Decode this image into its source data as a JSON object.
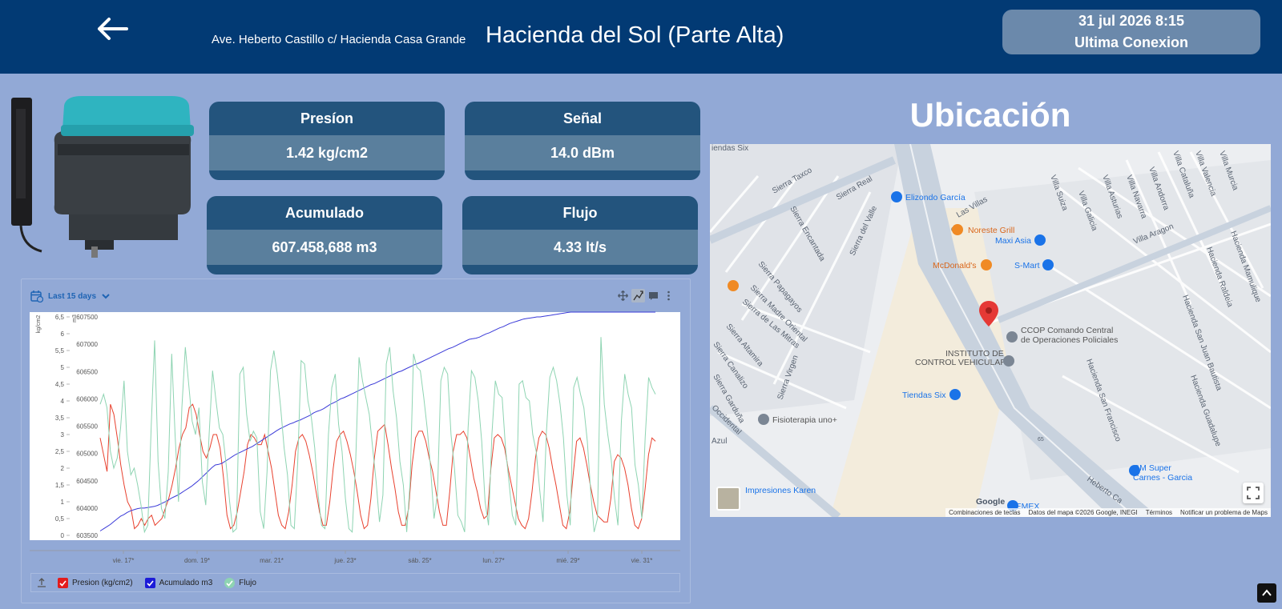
{
  "header": {
    "address": "Ave. Heberto Castillo c/ Hacienda Casa Grande",
    "title": "Hacienda del Sol (Parte Alta)",
    "last_connection_datetime": "31 jul 2026 8:15",
    "last_connection_label": "Ultima Conexion",
    "back_icon": "arrow-left-icon"
  },
  "cards": {
    "pressure": {
      "label": "Presíon",
      "value": "1.42 kg/cm2"
    },
    "signal": {
      "label": "Señal",
      "value": "14.0 dBm"
    },
    "accumulated": {
      "label": "Acumulado",
      "value": "607.458,688 m3"
    },
    "flow": {
      "label": "Flujo",
      "value": "4.33 lt/s"
    }
  },
  "chart_controls": {
    "range_label": "Last 15 days",
    "range_icon": "calendar-icon",
    "tools": [
      "move-icon",
      "zoom-icon",
      "comment-icon",
      "more-vertical-icon"
    ]
  },
  "chart_data": {
    "type": "line",
    "x": [
      "vie. 17*",
      "dom. 19*",
      "mar. 21*",
      "jue. 23*",
      "sáb. 25*",
      "lun. 27*",
      "mié. 29*",
      "vie. 31*"
    ],
    "left_axis": {
      "label": "kg/cm2",
      "ticks": [
        "6,5",
        "6",
        "5,5",
        "5",
        "4,5",
        "4",
        "3,5",
        "3",
        "2,5",
        "2",
        "1,5",
        "1",
        "0,5",
        "0"
      ],
      "ylim": [
        0,
        6.5
      ]
    },
    "right_axis": {
      "label": "m3",
      "ticks": [
        "607500",
        "607000",
        "606500",
        "606000",
        "605500",
        "605000",
        "604500",
        "604000",
        "603500"
      ],
      "ylim": [
        603500,
        607500
      ]
    },
    "series": [
      {
        "name": "Presion (kg/cm2)",
        "color": "#e8412e",
        "axis": "left",
        "values": [
          2.9,
          2.4,
          1.9,
          3.9,
          3.6,
          2.9,
          2.1,
          1.5,
          1.0,
          0.8,
          0.2,
          0.3,
          0.5,
          0.3,
          0.5,
          0.6,
          0.3,
          0.4,
          0.5,
          0.8,
          1.1,
          1.5,
          2.0,
          2.6,
          3.0,
          3.2,
          3.8,
          3.9,
          3.6,
          3.0,
          2.5,
          2.3,
          2.6,
          3.0,
          3.0,
          2.6,
          1.7,
          0.6,
          0.2,
          0.3,
          0.7,
          1.3,
          1.9,
          2.7,
          3.0,
          2.9,
          2.7,
          2.7,
          3.0,
          2.5,
          2.0,
          1.3,
          0.6,
          0.3,
          0.2,
          0.7,
          1.5,
          2.5,
          2.9,
          3.0,
          2.8,
          2.4,
          1.9,
          1.3,
          0.7,
          0.3,
          0.3,
          1.0,
          2.0,
          2.8,
          3.0,
          3.1,
          2.8,
          2.4,
          1.9,
          1.3,
          0.6,
          0.2,
          0.3,
          1.1,
          2.3,
          3.1,
          3.2,
          3.3,
          2.7,
          2.0,
          1.4,
          0.7,
          0.3,
          0.3,
          0.8,
          2.1,
          2.9,
          3.1,
          3.1,
          2.8,
          2.3,
          1.9,
          1.3,
          0.7,
          0.3,
          0.3,
          1.3,
          2.5,
          3.0,
          3.0,
          3.1,
          2.9,
          2.3,
          1.7,
          1.3,
          0.8,
          0.5,
          0.6,
          2.0,
          2.9,
          3.0,
          2.9,
          2.6,
          2.0,
          1.5,
          1.0,
          0.5,
          0.3,
          0.2,
          0.5,
          1.3,
          2.3,
          2.9,
          3.1,
          3.0,
          2.6,
          2.0,
          1.5,
          0.9,
          0.3,
          0.2,
          0.7,
          1.8,
          2.8,
          2.9,
          2.6,
          2.1,
          1.5,
          1.0,
          0.6,
          0.5,
          0.4,
          0.4,
          1.1,
          2.2,
          2.4,
          2.3,
          2.0,
          1.5,
          0.8,
          0.3,
          0.2,
          0.5,
          1.4,
          2.4,
          2.9,
          2.8
        ]
      },
      {
        "name": "Acumulado m3",
        "color": "#3a3ad8",
        "axis": "right",
        "values": [
          603580,
          603620,
          603660,
          603700,
          603750,
          603800,
          603850,
          603880,
          603920,
          603950,
          603970,
          603990,
          604000,
          604000,
          604010,
          604020,
          604030,
          604050,
          604080,
          604110,
          604140,
          604180,
          604210,
          604240,
          604280,
          604320,
          604360,
          604400,
          604450,
          604500,
          604560,
          604620,
          604680,
          604740,
          604790,
          604800,
          604820,
          604860,
          604900,
          604940,
          604980,
          605010,
          605040,
          605070,
          605100,
          605130,
          605170,
          605210,
          605250,
          605290,
          605330,
          605370,
          605410,
          605450,
          605480,
          605510,
          605540,
          605560,
          605590,
          605610,
          605640,
          605670,
          605700,
          605740,
          605770,
          605790,
          605820,
          605860,
          605900,
          605930,
          605960,
          606000,
          606020,
          606050,
          606080,
          606110,
          606140,
          606170,
          606200,
          606230,
          606260,
          606280,
          606310,
          606340,
          606370,
          606400,
          606430,
          606460,
          606490,
          606510,
          606540,
          606570,
          606600,
          606630,
          606650,
          606680,
          606710,
          606740,
          606770,
          606800,
          606830,
          606860,
          606890,
          606920,
          606940,
          606970,
          607000,
          607030,
          607060,
          607090,
          607100,
          607110,
          607130,
          607160,
          607190,
          607210,
          607240,
          607270,
          607300,
          607320,
          607350,
          607380,
          607400,
          607420,
          607440,
          607460,
          607470,
          607480,
          607490,
          607500,
          607500,
          607510,
          607520,
          607530,
          607540,
          607550,
          607560,
          607570,
          607580,
          607590,
          607600,
          607610,
          607620,
          607630,
          607640,
          607650,
          607660,
          607670,
          607680,
          607690,
          607700,
          607710,
          607720,
          607730,
          607740,
          607750,
          607760,
          607770,
          607780,
          607790,
          607800,
          607810,
          607820,
          607830,
          607840
        ]
      },
      {
        "name": "Flujo",
        "color": "#8ed4b2",
        "axis": "left",
        "values": [
          3.9,
          4.2,
          3.8,
          2.5,
          2.0,
          2.3,
          3.2,
          4.6,
          2.5,
          1.8,
          2.0,
          1.5,
          0.9,
          0.1,
          0.3,
          3.3,
          5.8,
          2.2,
          0.8,
          0.5,
          1.9,
          5.4,
          3.0,
          1.0,
          3.8,
          5.6,
          4.5,
          3.4,
          3.0,
          3.8,
          1.6,
          0.9,
          3.0,
          4.9,
          4.0,
          3.2,
          3.0,
          2.1,
          1.0,
          0.1,
          0.2,
          4.8,
          5.0,
          3.6,
          2.8,
          3.1,
          2.9,
          0.7,
          0.2,
          1.9,
          4.9,
          5.5,
          4.8,
          3.8,
          2.6,
          1.8,
          0.3,
          0.2,
          2.2,
          5.2,
          5.1,
          4.0,
          3.5,
          2.6,
          1.2,
          0.3,
          0.2,
          3.0,
          4.4,
          4.8,
          3.3,
          2.5,
          1.1,
          0.2,
          0.1,
          2.2,
          5.3,
          4.6,
          4.1,
          3.6,
          2.6,
          1.6,
          0.4,
          1.2,
          5.1,
          5.6,
          4.3,
          3.5,
          2.2,
          1.5,
          0.1,
          1.6,
          5.4,
          5.0,
          4.9,
          4.1,
          3.2,
          2.0,
          0.5,
          1.2,
          4.6,
          5.0,
          4.8,
          3.0,
          2.0,
          0.6,
          0.4,
          0.1,
          3.2,
          4.9,
          4.7,
          4.0,
          2.8,
          1.0,
          0.3,
          3.0,
          4.6,
          4.2,
          4.1,
          2.6,
          1.6,
          0.6,
          0.3,
          4.5,
          4.6,
          4.1,
          4.0,
          3.0,
          2.5,
          1.4,
          0.4,
          3.1,
          4.7,
          5.0,
          4.6,
          3.9,
          2.9,
          1.2,
          0.3,
          4.4,
          4.7,
          4.2,
          3.8,
          2.8,
          1.3,
          0.1,
          0.5,
          5.9,
          3.9,
          3.0,
          2.3,
          1.1,
          0.3,
          3.4,
          4.8,
          4.2,
          3.8,
          2.1,
          1.5,
          0.5,
          2.9,
          4.7,
          4.4,
          4.2
        ]
      }
    ]
  },
  "map": {
    "heading": "Ubicación",
    "labels": {
      "tiendas_six_top": "iendas Six",
      "sierra_taxco": "Sierra Taxco",
      "sierra_real": "Sierra Real",
      "elizondo": "Elizondo García",
      "las_villas": "Las Villas",
      "noreste_grill": "Noreste Grill",
      "maxi_asia": "Maxi Asia",
      "mcdonalds": "McDonald's",
      "s_mart": "S-Mart",
      "villa_aragon": "Villa Aragon",
      "ccop_1": "CCOP Comando Central",
      "ccop_2": "de Operaciones Policiales",
      "instituto_1": "INSTITUTO DE",
      "instituto_2": "CONTROL VEHICULAR",
      "tiendas_six": "Tiendas Six",
      "fisioterapia": "Fisioterapia uno+",
      "impresiones": "Impresiones Karen",
      "gm_super_1": "GM Super",
      "gm_super_2": "Carnes - Garcia",
      "cemex": "CEMEX",
      "google": "Google",
      "heberto": "Heberto Ca",
      "sierra_encantada": "Sierra Encantada",
      "sierra_del_valle": "Sierra del Valle",
      "sierra_papagayos": "Sierra Papagayos",
      "sierra_madre": "Sierra Madre Oriental",
      "sierra_mitras": "Sierra de Las Mitras",
      "sierra_altamira": "Sierra Altamira",
      "sierra_canalizo": "Sierra Canalizo",
      "sierra_virgen": "Sierra Virgen",
      "sierra_garduna": "Sierra Garduña",
      "occidental": "Occidental",
      "azul": "Azul",
      "hacienda_san_juan": "Hacienda San Juan Bautista",
      "hacienda_san_francisco": "Hacienda San Francisco",
      "hacienda_guadalupe": "Hacienda Guadalupe",
      "hacienda_raldeia": "Hacienda Raldeia",
      "hacienda_mamulique": "Hacienda Mamulique",
      "villa_suiza": "Villa Suiza",
      "villa_galicia": "Villa Galicia",
      "villa_asturias": "Villa Asturias",
      "villa_navarra": "Villa Navarra",
      "villa_andorra": "Villa Andorra",
      "villa_cataluna": "Villa Cataluña",
      "villa_valencia": "Villa Valencia",
      "villa_murcia": "Villa Murcia",
      "route_65": "65"
    },
    "attribution": [
      "Combinaciones de teclas",
      "Datos del mapa ©2026 Google, INEGI",
      "Términos",
      "Notificar un problema de Maps"
    ],
    "marker_icon": "map-pin-icon",
    "fullscreen_icon": "fullscreen-icon"
  },
  "colors": {
    "header_bg": "#023a74",
    "page_bg": "#92a9d6",
    "card_header": "#23547d",
    "card_value": "#5a7f9d"
  }
}
